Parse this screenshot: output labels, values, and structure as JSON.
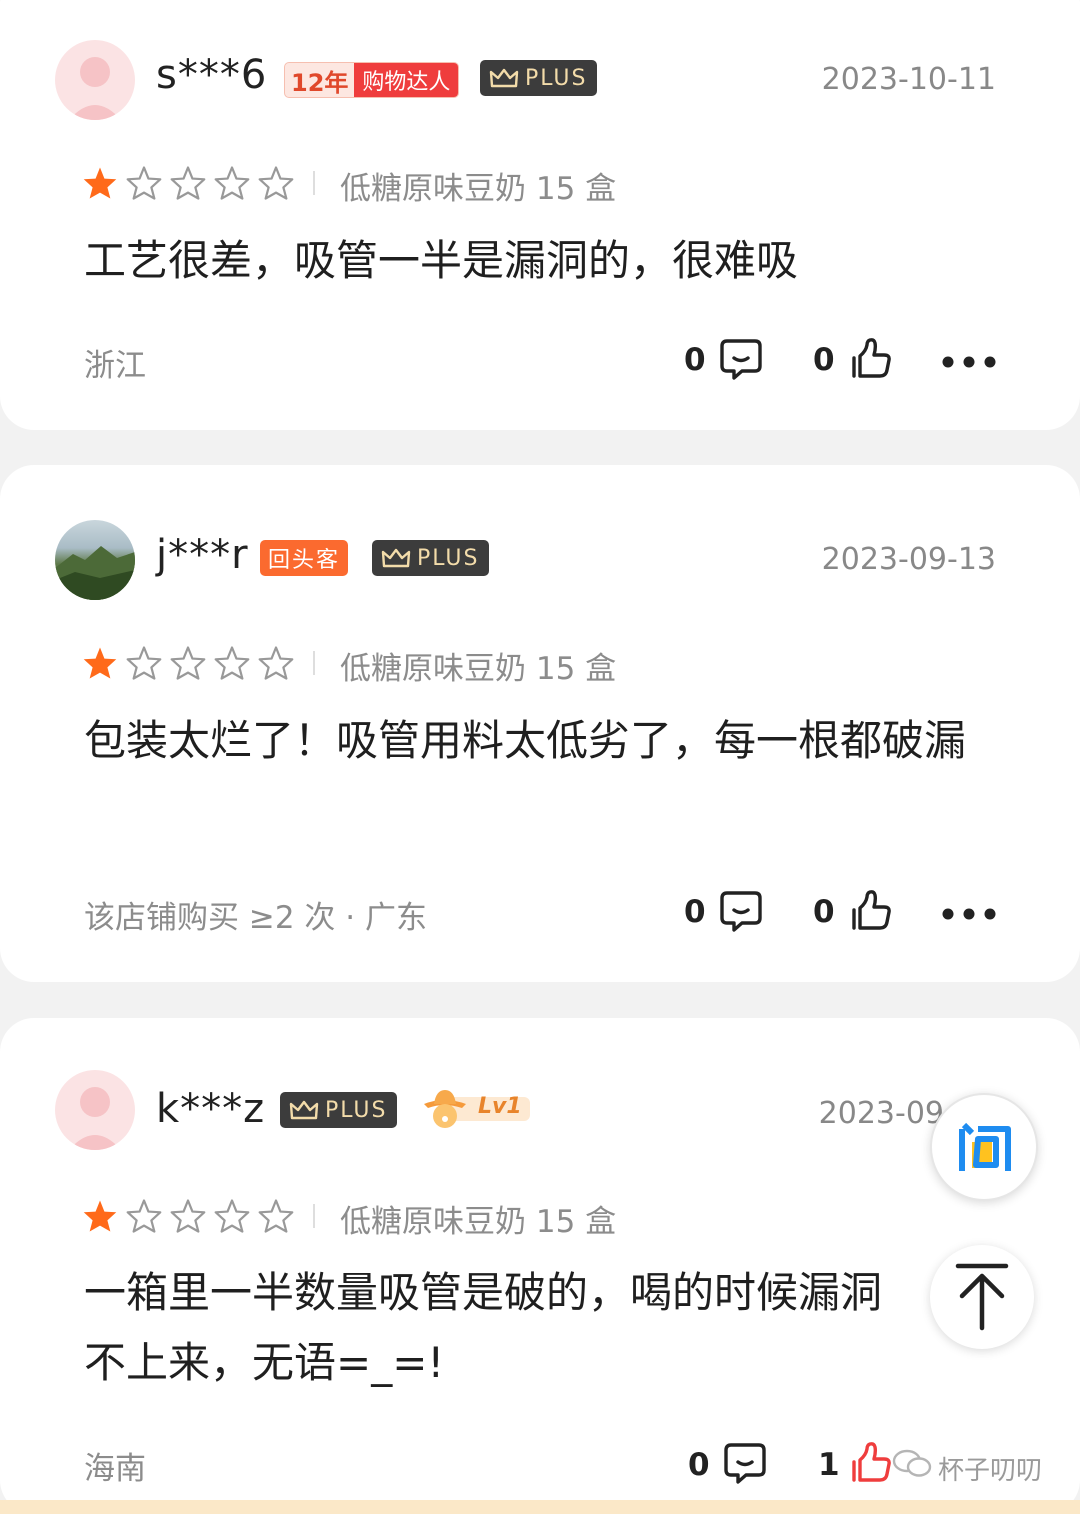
{
  "reviews": [
    {
      "username": "s***6",
      "badges": {
        "years": "12年",
        "title": "购物达人",
        "plus": "PLUS"
      },
      "date": "2023-10-11",
      "rating": 1,
      "variant": "低糖原味豆奶 15 盒",
      "content": "工艺很差，吸管一半是漏洞的，很难吸",
      "meta": "浙江",
      "comment_count": "0",
      "like_count": "0"
    },
    {
      "username": "j***r",
      "badges": {
        "tag": "回头客",
        "plus": "PLUS"
      },
      "date": "2023-09-13",
      "rating": 1,
      "variant": "低糖原味豆奶 15 盒",
      "content": "包装太烂了！吸管用料太低劣了，每一根都破漏",
      "meta": "该店铺购买 ≥2 次 · 广东",
      "comment_count": "0",
      "like_count": "0"
    },
    {
      "username": "k***z",
      "badges": {
        "plus": "PLUS",
        "level": "Lv1"
      },
      "date": "2023-09",
      "rating": 1,
      "variant": "低糖原味豆奶 15 盒",
      "content": "一箱里一半数量吸管是破的，喝的时候漏洞 不上来，无语=_=!",
      "meta": "海南",
      "comment_count": "0",
      "like_count": "1"
    }
  ],
  "floating": {
    "ask_label": "问",
    "top_icon": "arrow-up-icon"
  },
  "watermark": "杯子叨叨",
  "colors": {
    "star_active": "#ff6a1a",
    "plus_bg": "#3c3c3c",
    "accent": "#ef3d3d"
  }
}
